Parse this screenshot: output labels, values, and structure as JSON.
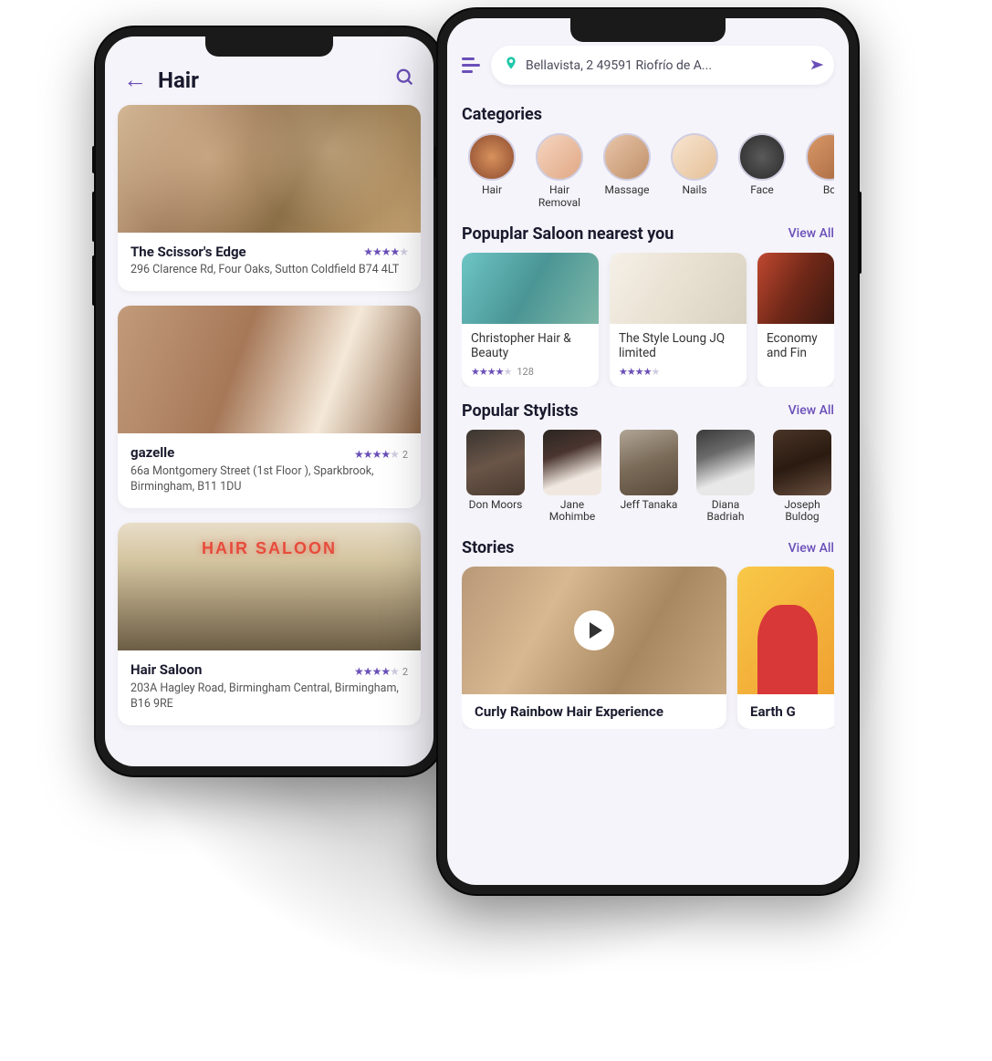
{
  "left": {
    "title": "Hair",
    "listings": [
      {
        "name": "The Scissor's Edge",
        "address": "296 Clarence Rd, Four Oaks, Sutton Coldfield B74 4LT",
        "rating": 4
      },
      {
        "name": "gazelle",
        "address": "66a Montgomery Street (1st Floor ), Sparkbrook, Birmingham, B11 1DU",
        "rating": 4,
        "reviews": "2"
      },
      {
        "name": "Hair Saloon",
        "address": "203A Hagley Road, Birmingham Central, Birmingham, B16 9RE",
        "rating": 4,
        "reviews": "2",
        "sign": "HAIR SALOON"
      }
    ]
  },
  "right": {
    "location": "Bellavista, 2 49591 Riofrío de A...",
    "sections": {
      "categories": {
        "title": "Categories"
      },
      "saloon": {
        "title": "Popuplar Saloon nearest you",
        "link": "View All"
      },
      "stylists": {
        "title": "Popular Stylists",
        "link": "View All"
      },
      "stories": {
        "title": "Stories",
        "link": "View All"
      }
    },
    "categories": [
      {
        "label": "Hair"
      },
      {
        "label": "Hair Removal"
      },
      {
        "label": "Massage"
      },
      {
        "label": "Nails"
      },
      {
        "label": "Face"
      },
      {
        "label": "Bo"
      }
    ],
    "saloons": [
      {
        "name": "Christopher Hair & Beauty",
        "rating": 4,
        "reviews": "128"
      },
      {
        "name": "The Style Loung JQ limited",
        "rating": 4
      },
      {
        "name": "Economy and Fin"
      }
    ],
    "stylists": [
      {
        "name": "Don Moors"
      },
      {
        "name": "Jane Mohimbe"
      },
      {
        "name": "Jeff Tanaka"
      },
      {
        "name": "Diana Badriah"
      },
      {
        "name": "Joseph Buldog"
      }
    ],
    "stories": [
      {
        "title": "Curly Rainbow Hair Experience"
      },
      {
        "title": "Earth G"
      }
    ]
  }
}
